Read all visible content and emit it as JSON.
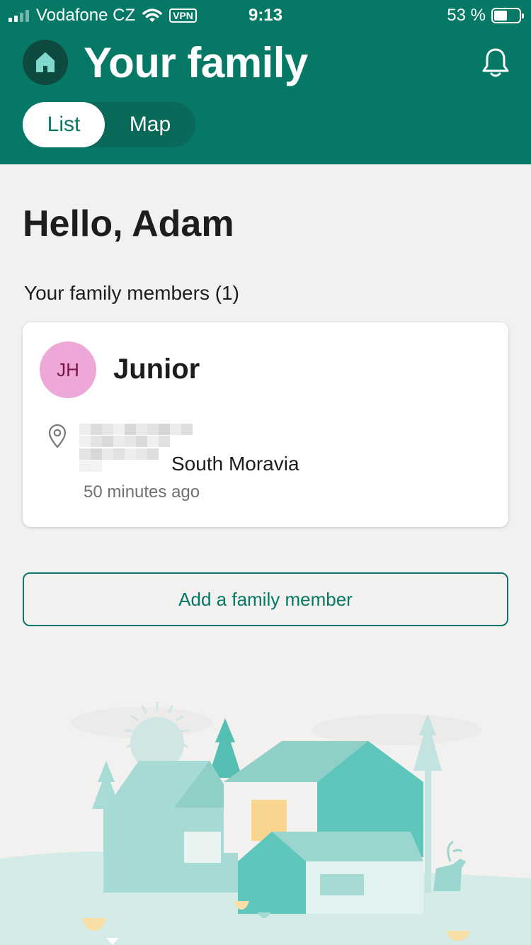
{
  "status_bar": {
    "carrier": "Vodafone CZ",
    "vpn": "VPN",
    "time": "9:13",
    "battery_text": "53 %",
    "battery_level": 0.53
  },
  "header": {
    "title": "Your family",
    "home_icon": "home-icon",
    "bell_icon": "bell-icon",
    "tabs": [
      {
        "label": "List",
        "selected": true
      },
      {
        "label": "Map",
        "selected": false
      }
    ]
  },
  "main": {
    "greeting": "Hello, Adam",
    "members_heading": "Your family members (1)",
    "members": [
      {
        "initials": "JH",
        "name": "Junior",
        "location_region": "South Moravia",
        "last_seen": "50 minutes ago"
      }
    ],
    "add_button_label": "Add a family member"
  },
  "colors": {
    "brand": "#067866",
    "avatar_bg": "#eda8d8",
    "background": "#f3f1ef"
  }
}
